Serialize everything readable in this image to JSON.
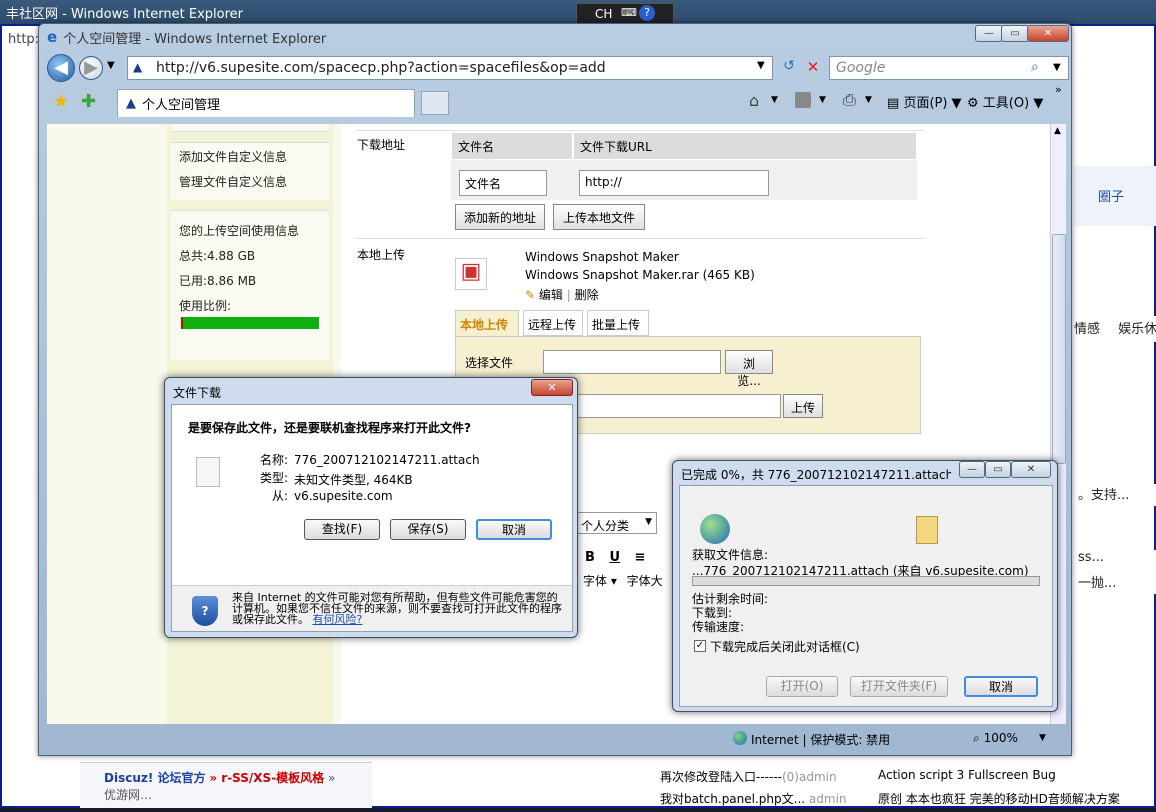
{
  "back_window": {
    "title": "丰社区网 - Windows Internet Explorer",
    "addr_fragment": "http:",
    "right_items": [
      "圈子",
      "情感",
      "娱乐休",
      "。支持...",
      "ss...",
      "一抛..."
    ],
    "bottom_links": [
      "Discuz! 论坛官方",
      "» r-SS/XS-模板风格",
      "» 优游网…"
    ],
    "list_items": [
      {
        "text": "再次修改登陆入口------",
        "meta": "(0)admin"
      },
      {
        "text": "我对batch.panel.php文...",
        "meta": "admin"
      }
    ],
    "right_links": [
      "Action script 3 Fullscreen Bug",
      "原创  本本也疯狂  完美的移动HD音频解决方案"
    ]
  },
  "langbar": {
    "label": "CH"
  },
  "main_window": {
    "title": "个人空间管理 - Windows Internet Explorer",
    "url": "http://v6.supesite.com/spacecp.php?action=spacefiles&op=add",
    "search_placeholder": "Google",
    "tab_label": "个人空间管理",
    "toolbar_page": "页面(P)",
    "toolbar_tools": "工具(O)"
  },
  "sidebar": {
    "items": [
      "添加文件自定义信息",
      "管理文件自定义信息"
    ],
    "usage_title": "您的上传空间使用信息",
    "total": "总共:4.88 GB",
    "used": "已用:8.86 MB",
    "ratio_label": "使用比例:"
  },
  "content": {
    "download_label": "下载地址",
    "col_filename": "文件名",
    "col_url": "文件下载URL",
    "filename_value": "文件名",
    "url_value": "http://",
    "add_addr_btn": "添加新的地址",
    "upload_local_btn": "上传本地文件",
    "local_upload_label": "本地上传",
    "file_title": "Windows Snapshot Maker",
    "file_name": "Windows Snapshot Maker.rar (465 KB)",
    "edit": "编辑",
    "delete": "删除",
    "tabs": [
      "本地上传",
      "远程上传",
      "批量上传"
    ],
    "choose_file": "选择文件",
    "browse_btn": "浏览...",
    "upload_btn": "上传",
    "category": "个人分类",
    "font": "字体",
    "font_size": "字体大"
  },
  "status": {
    "zone": "Internet | 保护模式: 禁用",
    "zoom": "100%"
  },
  "download_dialog": {
    "title": "文件下载",
    "question": "是要保存此文件，还是要联机查找程序来打开此文件?",
    "name_label": "名称:",
    "name_value": "776_200712102147211.attach",
    "type_label": "类型:",
    "type_value": "未知文件类型, 464KB",
    "from_label": "从:",
    "from_value": "v6.supesite.com",
    "find_btn": "查找(F)",
    "save_btn": "保存(S)",
    "cancel_btn": "取消",
    "warning": "来自 Internet 的文件可能对您有所帮助，但有些文件可能危害您的计算机。如果您不信任文件的来源，则不要查找可打开此文件的程序或保存此文件。",
    "risk_link": "有何风险?"
  },
  "progress_dialog": {
    "title": "已完成 0%，共 776_200712102147211.attach (...",
    "getting_info": "获取文件信息:",
    "file_line": "...776_200712102147211.attach (来自 v6.supesite.com)",
    "time_left": "估计剩余时间:",
    "download_to": "下载到:",
    "speed": "传输速度:",
    "close_checkbox": "下载完成后关闭此对话框(C)",
    "open_btn": "打开(O)",
    "open_folder_btn": "打开文件夹(F)",
    "cancel_btn": "取消"
  }
}
